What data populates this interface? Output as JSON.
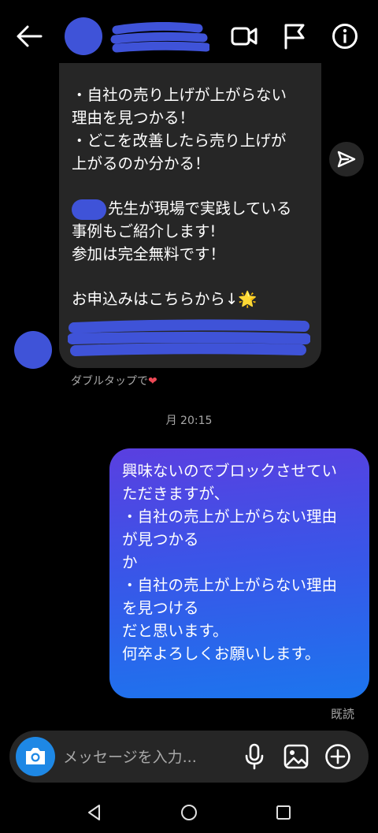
{
  "header": {
    "back_icon": "arrow-left-icon",
    "video_icon": "video-camera-icon",
    "flag_icon": "flag-icon",
    "info_icon": "info-icon"
  },
  "incoming_message": {
    "lines": [
      "・自社の売り上げが上がらない",
      "理由を見つかる！",
      "・どこを改善したら売り上げが",
      "上がるのか分かる！",
      "",
      "先生が現場で実践している",
      "事例もご紹介します!",
      "参加は完全無料です！",
      "",
      "お申込みはこちらから↓"
    ],
    "star_emoji": "🌟"
  },
  "hint": {
    "text": "ダブルタップで",
    "heart": "❤"
  },
  "timestamp": "月 20:15",
  "outgoing_message": {
    "lines": [
      "興味ないのでブロックさせてい",
      "ただきますが、",
      "・自社の売上が上がらない理由",
      "が見つかる",
      "か",
      "・自社の売上が上がらない理由",
      "を見つける",
      "だと思います。",
      "何卒よろしくお願いします。"
    ]
  },
  "seen_label": "既読",
  "composer": {
    "placeholder": "メッセージを入力...",
    "camera_icon": "camera-icon",
    "mic_icon": "microphone-icon",
    "gallery_icon": "image-icon",
    "plus_icon": "plus-circle-icon"
  },
  "colors": {
    "background": "#000000",
    "incoming_bubble": "#262626",
    "outgoing_gradient_top": "#5a3fe0",
    "outgoing_gradient_bottom": "#1c75ee",
    "redaction": "#3f53d8",
    "camera_button": "#1e88e5"
  }
}
